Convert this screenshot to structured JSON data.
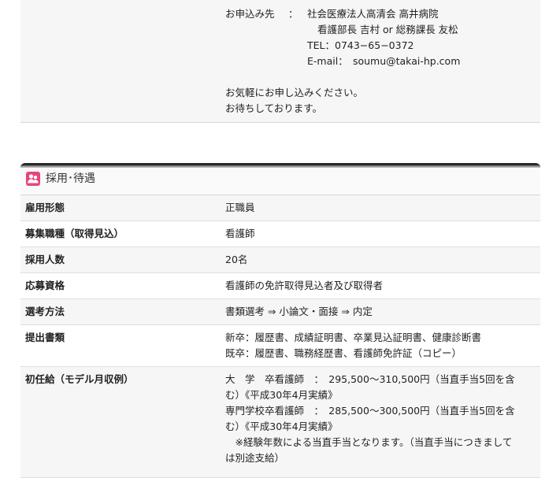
{
  "contact": {
    "label": "お申込み先",
    "colon": "：",
    "org": "社会医療法人高清会 高井病院",
    "persons": "看護部長 吉村 or 総務課長 友松",
    "tel": "TEL：0743−65−0372",
    "email": "E-mail：　soumu@takai-hp.com",
    "closing1": "お気軽にお申し込みください。",
    "closing2": "お待ちしております。"
  },
  "section": {
    "icon": "people-icon",
    "title": "採用･待遇"
  },
  "rows": [
    {
      "label": "雇用形態",
      "lines": [
        "正職員"
      ]
    },
    {
      "label": "募集職種（取得見込）",
      "lines": [
        "看護師"
      ]
    },
    {
      "label": "採用人数",
      "lines": [
        "20名"
      ]
    },
    {
      "label": "応募資格",
      "lines": [
        "看護師の免許取得見込者及び取得者"
      ]
    },
    {
      "label": "選考方法",
      "lines": [
        "書類選考 ⇒ 小論文・面接 ⇒ 内定"
      ]
    },
    {
      "label": "提出書類",
      "lines": [
        "新卒：履歴書、成績証明書、卒業見込証明書、健康診断書",
        "既卒：履歴書、職務経歴書、看護師免許証（コピー）"
      ]
    },
    {
      "label": "初任給（モデル月収例）",
      "lines": [
        "大　学　卒看護師　：　295,500〜310,500円（当直手当5回を含",
        "む）《平成30年4月実績》",
        "専門学校卒看護師　：　285,500〜300,500円（当直手当5回を含",
        "む）《平成30年4月実績》",
        "　※経験年数による当直手当となります。（当直手当につきまして",
        "は別途支給）"
      ]
    }
  ],
  "colors": {
    "accent": "#e8457a",
    "rowAlt": "#f6f6f6",
    "border": "#dedede"
  }
}
